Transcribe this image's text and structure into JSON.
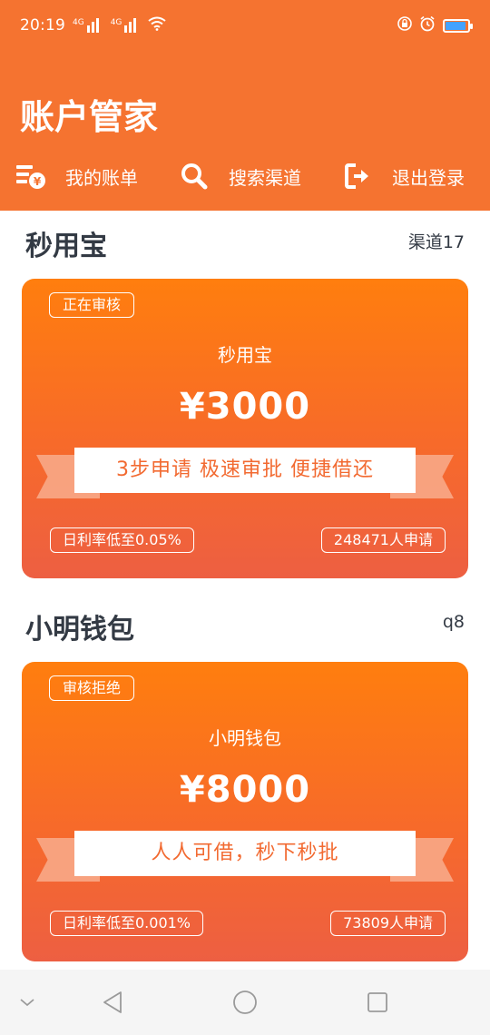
{
  "status_bar": {
    "time": "20:19",
    "signal1_tag": "4G",
    "signal2_tag": "4G",
    "icons": [
      "signal-icon",
      "signal-icon",
      "wifi-icon",
      "lock-icon",
      "alarm-icon",
      "battery-icon"
    ],
    "battery_color": "#43a2ff"
  },
  "app": {
    "title": "账户管家",
    "header_color": "#f57330"
  },
  "nav": {
    "bills": {
      "label": "我的账单",
      "icon": "bill-icon"
    },
    "search": {
      "label": "搜索渠道",
      "icon": "search-icon"
    },
    "logout": {
      "label": "退出登录",
      "icon": "logout-icon"
    }
  },
  "channels": [
    {
      "section_title": "秒用宝",
      "section_right": "渠道17",
      "status": "正在审核",
      "name": "秒用宝",
      "amount": "¥3000",
      "slogan": "3步申请  极速审批   便捷借还",
      "rate": "日利率低至0.05%",
      "applicants": "248471人申请"
    },
    {
      "section_title": "小明钱包",
      "section_right": "q8",
      "status": "审核拒绝",
      "name": "小明钱包",
      "amount": "¥8000",
      "slogan": "人人可借，秒下秒批",
      "rate": "日利率低至0.001%",
      "applicants": "73809人申请"
    }
  ],
  "system_nav": {
    "icons": [
      "chevron-down-icon",
      "back-triangle-icon",
      "home-circle-icon",
      "recents-square-icon"
    ]
  }
}
